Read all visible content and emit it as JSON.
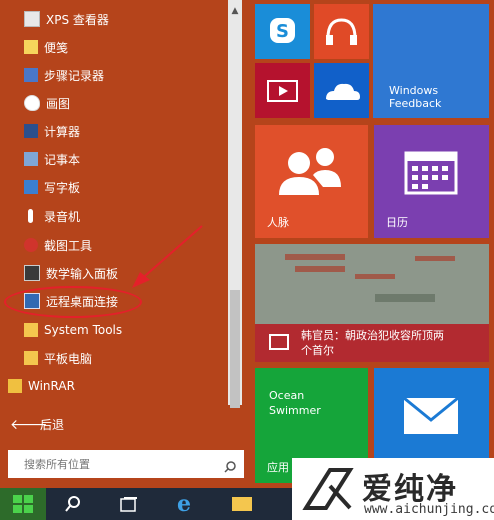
{
  "app_list": [
    {
      "label": "XPS 查看器",
      "icon": "xps-viewer-icon",
      "cls": "doc"
    },
    {
      "label": "便笺",
      "icon": "sticky-notes-icon",
      "cls": "note"
    },
    {
      "label": "步骤记录器",
      "icon": "steps-recorder-icon",
      "cls": "steps"
    },
    {
      "label": "画图",
      "icon": "paint-icon",
      "cls": "paint"
    },
    {
      "label": "计算器",
      "icon": "calculator-icon",
      "cls": "calc"
    },
    {
      "label": "记事本",
      "icon": "notepad-icon",
      "cls": "notepad"
    },
    {
      "label": "写字板",
      "icon": "wordpad-icon",
      "cls": "wordpad"
    },
    {
      "label": "录音机",
      "icon": "sound-recorder-icon",
      "cls": "mic"
    },
    {
      "label": "截图工具",
      "icon": "snipping-tool-icon",
      "cls": "snip"
    },
    {
      "label": "数学输入面板",
      "icon": "math-input-icon",
      "cls": "math"
    },
    {
      "label": "远程桌面连接",
      "icon": "remote-desktop-icon",
      "cls": "rdp"
    },
    {
      "label": "System Tools",
      "icon": "folder-icon",
      "cls": "folder"
    },
    {
      "label": "平板电脑",
      "icon": "tablet-folder-icon",
      "cls": "tablet"
    },
    {
      "label": "WinRAR",
      "icon": "winrar-folder-icon",
      "cls": "winrar"
    }
  ],
  "back_label": "后退",
  "search": {
    "placeholder": "搜索所有位置"
  },
  "tiles": {
    "feedback_line1": "Windows",
    "feedback_line2": "Feedback",
    "people": "人脉",
    "calendar": "日历",
    "news_line1": "韩官员：朝政治犯收容所顶两",
    "news_line2": "个首尔",
    "ocean_line1": "Ocean",
    "ocean_line2": "Swimmer",
    "app_store_partial": "应用"
  },
  "watermark": {
    "text": "爱纯净",
    "url": "www.aichunjing.com"
  },
  "colors": {
    "start_bg": "#b5441b",
    "skype": "#1a8dd8",
    "music": "#e04a27",
    "video": "#b5122e",
    "onedrive": "#1160c9",
    "feedback": "#2f78d2",
    "people": "#e0502b",
    "calendar": "#7b3fb0",
    "news_band": "#b22a30",
    "ocean": "#15a53a",
    "mail": "#1b7ad4",
    "taskbar": "#1f2a3a",
    "highlight": "#e4202a"
  }
}
